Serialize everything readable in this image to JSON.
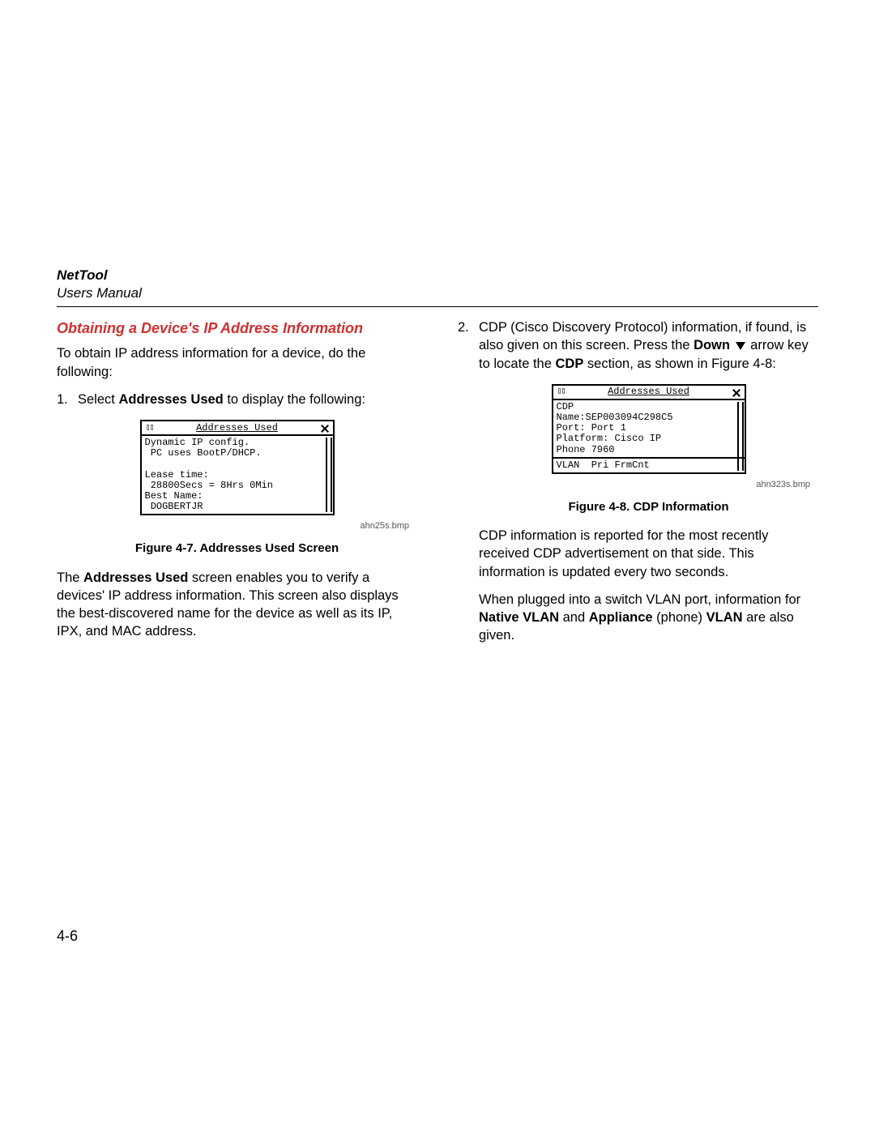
{
  "header": {
    "product": "NetTool",
    "subtitle": "Users Manual"
  },
  "left": {
    "section_title": "Obtaining a Device's IP Address Information",
    "intro": "To obtain IP address information for a device, do the following:",
    "step1_num": "1.",
    "step1_pre": "Select ",
    "step1_bold": "Addresses Used",
    "step1_post": " to display the following:",
    "screen_title": "Addresses Used",
    "screen_body": "Dynamic IP config.\n PC uses BootP/DHCP.\n\nLease time:\n 28800Secs = 8Hrs 0Min\nBest Name:\n DOGBERTJR",
    "img_tag": "ahn25s.bmp",
    "fig_caption": "Figure 4-7. Addresses Used Screen",
    "para_pre": "The ",
    "para_bold": "Addresses Used",
    "para_post": " screen enables you to verify a devices' IP address information. This screen also displays the best-discovered name for the device as well as its IP, IPX, and MAC address."
  },
  "right": {
    "step2_num": "2.",
    "step2_text_a": "CDP (Cisco Discovery Protocol) information, if found, is also given on this screen. Press the ",
    "step2_bold_down": "Down",
    "step2_text_b": " arrow key to locate the ",
    "step2_bold_cdp": "CDP",
    "step2_text_c": " section, as shown in Figure 4-8:",
    "screen_title": "Addresses Used",
    "screen_body_top": "CDP\nName:SEP003094C298C5\nPort: Port 1\nPlatform: Cisco IP\nPhone 7960",
    "screen_body_bottom": "VLAN  Pri FrmCnt",
    "img_tag": "ahn323s.bmp",
    "fig_caption": "Figure 4-8. CDP Information",
    "para1": "CDP information is reported for the most recently received CDP advertisement on that side. This information is updated every two seconds.",
    "para2_a": "When plugged into a switch VLAN port, information for ",
    "para2_b1": "Native VLAN",
    "para2_mid": " and ",
    "para2_b2": "Appliance",
    "para2_c": " (phone) ",
    "para2_b3": "VLAN",
    "para2_d": " are also given."
  },
  "page_number": "4-6"
}
